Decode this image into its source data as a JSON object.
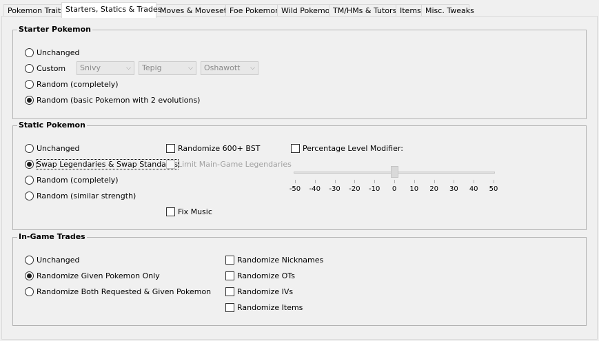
{
  "tabs": [
    {
      "label": "Pokemon Traits"
    },
    {
      "label": "Starters, Statics & Trades",
      "active": true
    },
    {
      "label": "Moves & Movesets"
    },
    {
      "label": "Foe Pokemon"
    },
    {
      "label": "Wild Pokemon"
    },
    {
      "label": "TM/HMs & Tutors"
    },
    {
      "label": "Items"
    },
    {
      "label": "Misc. Tweaks"
    }
  ],
  "starter": {
    "title": "Starter Pokemon",
    "options": [
      {
        "label": "Unchanged",
        "selected": false
      },
      {
        "label": "Custom",
        "selected": false
      },
      {
        "label": "Random (completely)",
        "selected": false
      },
      {
        "label": "Random (basic Pokemon with 2 evolutions)",
        "selected": true
      }
    ],
    "custom_choices": [
      "Snivy",
      "Tepig",
      "Oshawott"
    ]
  },
  "static": {
    "title": "Static Pokemon",
    "options": [
      {
        "label": "Unchanged",
        "selected": false
      },
      {
        "label": "Swap Legendaries & Swap Standards",
        "selected": true
      },
      {
        "label": "Random (completely)",
        "selected": false
      },
      {
        "label": "Random (similar strength)",
        "selected": false
      }
    ],
    "randomize_600_bst": {
      "label": "Randomize 600+ BST",
      "checked": false
    },
    "limit_main_game_legendaries": {
      "label": "Limit Main-Game Legendaries",
      "checked": false,
      "enabled": false
    },
    "fix_music": {
      "label": "Fix Music",
      "checked": false
    },
    "percentage_level_modifier": {
      "label": "Percentage Level Modifier:",
      "checked": false
    },
    "level_slider": {
      "value": 0,
      "min": -50,
      "max": 50,
      "enabled": false,
      "ticks": [
        "-50",
        "-40",
        "-30",
        "-20",
        "-10",
        "0",
        "10",
        "20",
        "30",
        "40",
        "50"
      ]
    }
  },
  "trades": {
    "title": "In-Game Trades",
    "options": [
      {
        "label": "Unchanged",
        "selected": false
      },
      {
        "label": "Randomize Given Pokemon Only",
        "selected": true
      },
      {
        "label": "Randomize Both Requested & Given Pokemon",
        "selected": false
      }
    ],
    "checks": [
      {
        "label": "Randomize Nicknames",
        "checked": false
      },
      {
        "label": "Randomize OTs",
        "checked": false
      },
      {
        "label": "Randomize IVs",
        "checked": false
      },
      {
        "label": "Randomize Items",
        "checked": false
      }
    ]
  }
}
